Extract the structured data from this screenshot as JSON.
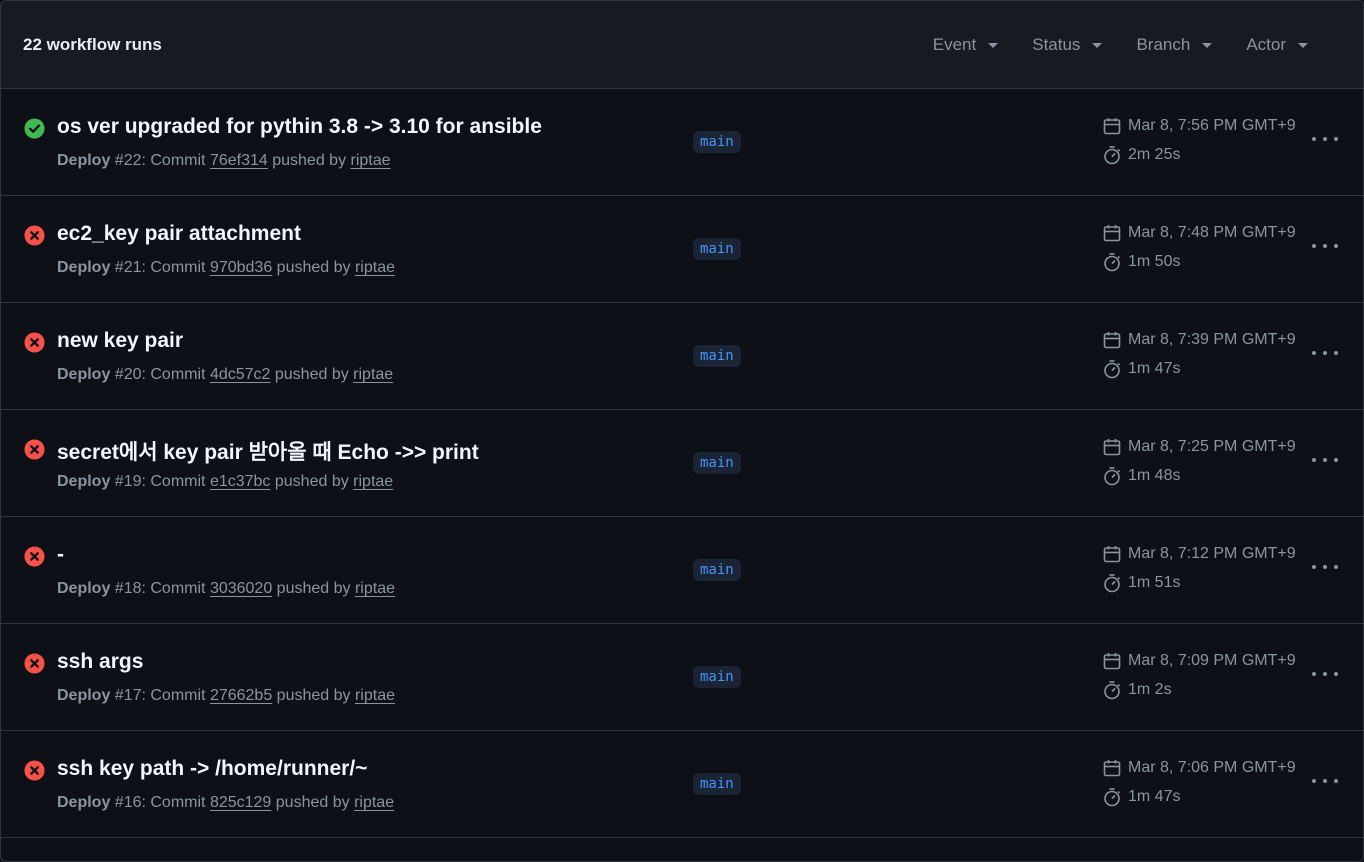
{
  "header": {
    "title": "22 workflow runs",
    "filters": [
      "Event",
      "Status",
      "Branch",
      "Actor"
    ]
  },
  "colors": {
    "success": "#3fb950",
    "failure": "#f85149",
    "branch_text": "#4493f8"
  },
  "runs": [
    {
      "status": "success",
      "status_icon": "check-circle-icon",
      "title": "os ver upgraded for pythin 3.8 -> 3.10 for ansible",
      "workflow": "Deploy",
      "run_label": " #22: Commit ",
      "commit": "76ef314",
      "pushed_by": " pushed by ",
      "actor": "riptae",
      "branch": "main",
      "date": "Mar 8, 7:56 PM GMT+9",
      "duration": "2m 25s"
    },
    {
      "status": "failure",
      "status_icon": "x-circle-icon",
      "title": "ec2_key pair attachment",
      "workflow": "Deploy",
      "run_label": " #21: Commit ",
      "commit": "970bd36",
      "pushed_by": " pushed by ",
      "actor": "riptae",
      "branch": "main",
      "date": "Mar 8, 7:48 PM GMT+9",
      "duration": "1m 50s"
    },
    {
      "status": "failure",
      "status_icon": "x-circle-icon",
      "title": "new key pair",
      "workflow": "Deploy",
      "run_label": " #20: Commit ",
      "commit": "4dc57c2",
      "pushed_by": " pushed by ",
      "actor": "riptae",
      "branch": "main",
      "date": "Mar 8, 7:39 PM GMT+9",
      "duration": "1m 47s"
    },
    {
      "status": "failure",
      "status_icon": "x-circle-icon",
      "title": "secret에서 key pair 받아올 때 Echo ->> print",
      "workflow": "Deploy",
      "run_label": " #19: Commit ",
      "commit": "e1c37bc",
      "pushed_by": " pushed by ",
      "actor": "riptae",
      "branch": "main",
      "date": "Mar 8, 7:25 PM GMT+9",
      "duration": "1m 48s"
    },
    {
      "status": "failure",
      "status_icon": "x-circle-icon",
      "title": "-",
      "workflow": "Deploy",
      "run_label": " #18: Commit ",
      "commit": "3036020",
      "pushed_by": " pushed by ",
      "actor": "riptae",
      "branch": "main",
      "date": "Mar 8, 7:12 PM GMT+9",
      "duration": "1m 51s"
    },
    {
      "status": "failure",
      "status_icon": "x-circle-icon",
      "title": "ssh args",
      "workflow": "Deploy",
      "run_label": " #17: Commit ",
      "commit": "27662b5",
      "pushed_by": " pushed by ",
      "actor": "riptae",
      "branch": "main",
      "date": "Mar 8, 7:09 PM GMT+9",
      "duration": "1m 2s"
    },
    {
      "status": "failure",
      "status_icon": "x-circle-icon",
      "title": "ssh key path -> /home/runner/~",
      "workflow": "Deploy",
      "run_label": " #16: Commit ",
      "commit": "825c129",
      "pushed_by": " pushed by ",
      "actor": "riptae",
      "branch": "main",
      "date": "Mar 8, 7:06 PM GMT+9",
      "duration": "1m 47s"
    }
  ]
}
